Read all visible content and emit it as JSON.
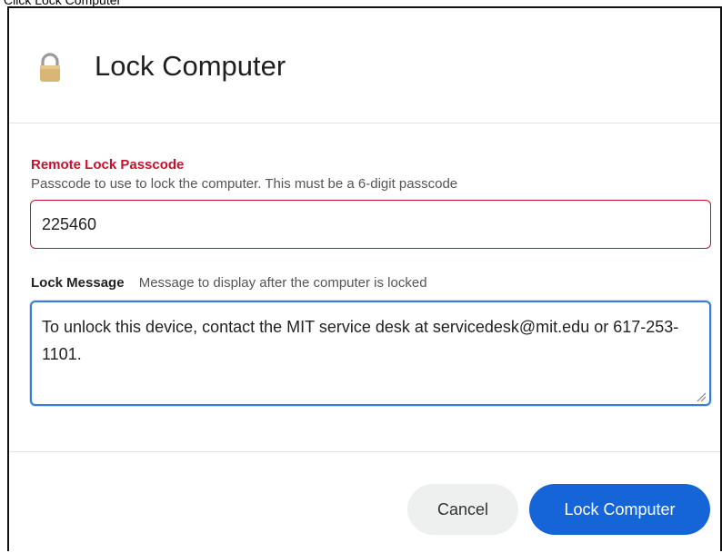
{
  "caption": "Click Lock Computer",
  "dialog": {
    "title": "Lock Computer",
    "icon": "lock-icon"
  },
  "passcode": {
    "label": "Remote Lock Passcode",
    "help": "Passcode to use to lock the computer. This must be a 6-digit passcode",
    "value": "225460"
  },
  "message": {
    "label": "Lock Message",
    "help": "Message to display after the computer is locked",
    "value": "To unlock this device, contact the MIT service desk at servicedesk@mit.edu or 617-253-1101."
  },
  "buttons": {
    "cancel": "Cancel",
    "lock": "Lock Computer"
  },
  "colors": {
    "required_label": "#c8102e",
    "primary": "#1565d8",
    "focus_border": "#3a7bd5"
  }
}
